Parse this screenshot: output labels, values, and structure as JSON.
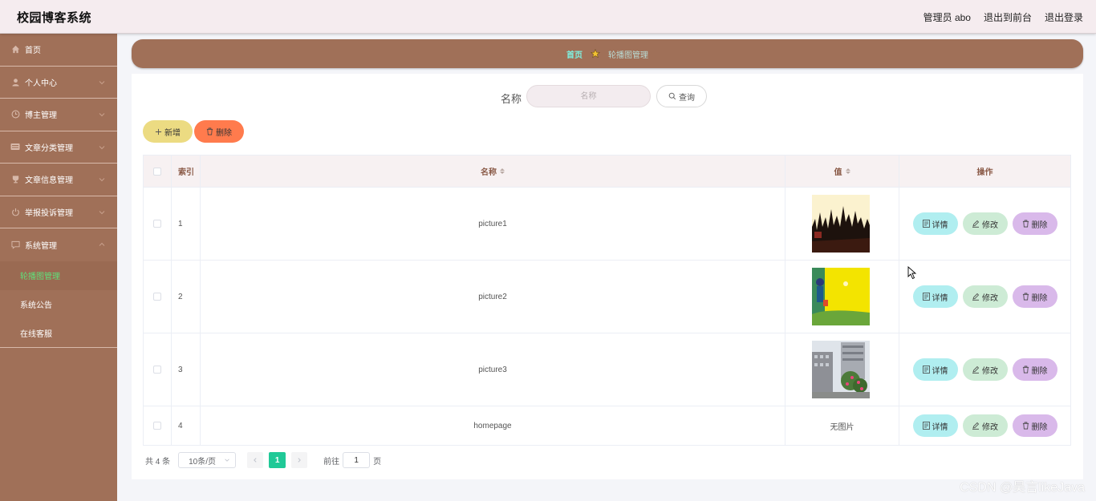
{
  "header": {
    "title": "校园博客系统",
    "admin_label": "管理员 abo",
    "front_label": "退出到前台",
    "logout_label": "退出登录"
  },
  "sidebar": {
    "items": [
      {
        "label": "首页",
        "icon": "home-icon"
      },
      {
        "label": "个人中心",
        "icon": "user-icon"
      },
      {
        "label": "博主管理",
        "icon": "clock-icon"
      },
      {
        "label": "文章分类管理",
        "icon": "folder-icon"
      },
      {
        "label": "文章信息管理",
        "icon": "trophy-icon"
      },
      {
        "label": "举报投诉管理",
        "icon": "power-icon"
      },
      {
        "label": "系统管理",
        "icon": "chat-icon"
      }
    ],
    "subitems": [
      {
        "label": "轮播图管理",
        "active": true
      },
      {
        "label": "系统公告",
        "active": false
      },
      {
        "label": "在线客服",
        "active": false
      }
    ]
  },
  "breadcrumb": {
    "home": "首页",
    "current": "轮播图管理"
  },
  "search": {
    "label": "名称",
    "placeholder": "名称",
    "button": "查询"
  },
  "actions": {
    "add": "新增",
    "delete": "删除"
  },
  "table": {
    "headers": {
      "index": "索引",
      "name": "名称",
      "value": "值",
      "ops": "操作"
    },
    "rows": [
      {
        "index": "1",
        "name": "picture1",
        "value_text": ""
      },
      {
        "index": "2",
        "name": "picture2",
        "value_text": ""
      },
      {
        "index": "3",
        "name": "picture3",
        "value_text": ""
      },
      {
        "index": "4",
        "name": "homepage",
        "value_text": "无图片"
      }
    ],
    "op_labels": {
      "detail": "详情",
      "edit": "修改",
      "remove": "删除"
    }
  },
  "pagination": {
    "total": "共 4 条",
    "page_size": "10条/页",
    "current_page": "1",
    "goto_prefix": "前往",
    "goto_value": "1",
    "goto_suffix": "页"
  },
  "watermark": "CSDN @昊言likeJava",
  "colors": {
    "sidebar": "#a07058",
    "header": "#f5ecef",
    "accent_active": "#5fe07a",
    "pager_active": "#20c997",
    "add_button": "#ecdb82",
    "delete_button": "#ff7b4d",
    "detail_button": "#b0eef0",
    "edit_button": "#cdebd5",
    "remove_button": "#d9b9ea"
  }
}
